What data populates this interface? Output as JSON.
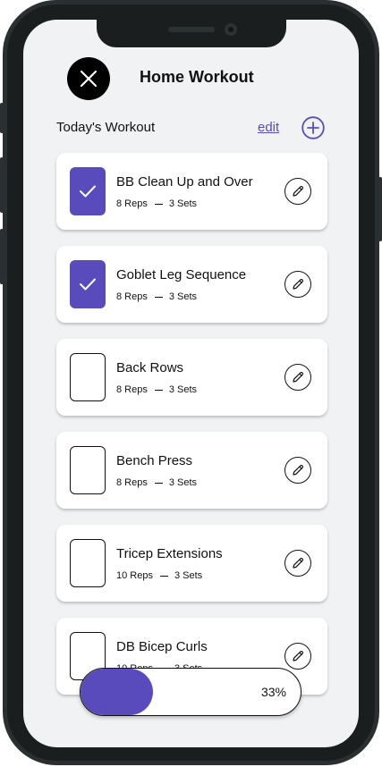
{
  "header": {
    "title": "Home Workout",
    "close_icon": "close-icon"
  },
  "section": {
    "title": "Today's Workout",
    "edit_label": "edit",
    "add_icon": "plus-circle-icon"
  },
  "exercises": [
    {
      "name": "BB Clean Up and Over",
      "reps": "8 Reps",
      "sets": "3 Sets",
      "completed": true
    },
    {
      "name": "Goblet Leg Sequence",
      "reps": "8 Reps",
      "sets": "3 Sets",
      "completed": true
    },
    {
      "name": "Back Rows",
      "reps": "8 Reps",
      "sets": "3 Sets",
      "completed": false
    },
    {
      "name": "Bench Press",
      "reps": "8 Reps",
      "sets": "3 Sets",
      "completed": false
    },
    {
      "name": "Tricep Extensions",
      "reps": "10 Reps",
      "sets": "3 Sets",
      "completed": false
    },
    {
      "name": "DB Bicep Curls",
      "reps": "10 Reps",
      "sets": "3 Sets",
      "completed": false
    }
  ],
  "progress": {
    "label": "33%",
    "value": 0.33
  },
  "colors": {
    "accent": "#5a4bbd",
    "background": "#f1f2f4"
  }
}
